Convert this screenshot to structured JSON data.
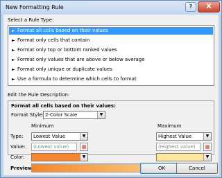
{
  "window": {
    "title": "New Formatting Rule",
    "help_glyph": "?",
    "close_glyph": "X"
  },
  "rule_type": {
    "label": "Select a Rule Type:",
    "items": [
      "Format all cells based on their values",
      "Format only cells that contain",
      "Format only top or bottom ranked values",
      "Format only values that are above or below average",
      "Format only unique or duplicate values",
      "Use a formula to determine which cells to format"
    ],
    "selected_index": 0
  },
  "description": {
    "label": "Edit the Rule Description:",
    "title": "Format all cells based on their values:",
    "format_style_label": "Format Style:",
    "format_style_value": "2-Color Scale",
    "minimum_header": "Minimum",
    "maximum_header": "Maximum",
    "type_label": "Type:",
    "value_label": "Value:",
    "color_label": "Color:",
    "min_type": "Lowest Value",
    "max_type": "Highest Value",
    "min_value": "(Lowest value)",
    "max_value": "(Highest value)",
    "min_color": "#f7852a",
    "max_color": "#fde79b",
    "preview_label": "Preview:"
  },
  "buttons": {
    "ok": "OK",
    "cancel": "Cancel"
  },
  "colors": {
    "selection": "#3399ff",
    "dialog_bg": "#f0f0f0",
    "frame": "#bcd3ec"
  }
}
